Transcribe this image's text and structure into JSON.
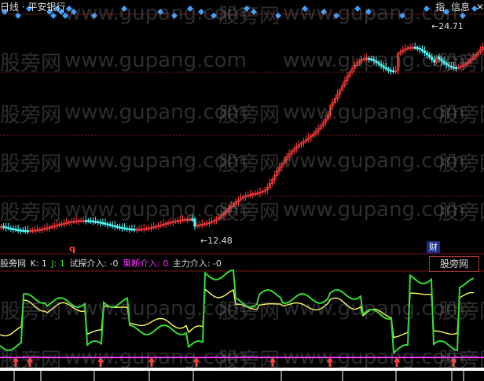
{
  "header": {
    "title": "日线 · 平安银行",
    "btn_index": "指",
    "btn_info": "信息",
    "btn_close": "✕"
  },
  "price_panel": {
    "high_label": "24.71",
    "low_label": "12.48",
    "marker_q": "q",
    "badge": "财"
  },
  "indicator_bar": {
    "name": "股旁网",
    "k_label": "K: 1",
    "j_label": "J: 1",
    "probe_label": "试探介入: -0",
    "decisive_label": "果断介入: 0",
    "main_label": "主力介入: -0",
    "tab_label": "股旁网"
  },
  "watermark": {
    "cn": "股旁网",
    "en": "www.gupang.com"
  },
  "colors": {
    "up": "#ff3c3c",
    "down": "#54ffff",
    "k_line": "#33dd33",
    "j_line": "#ffff66",
    "magenta": "#ff33ff",
    "diamond": "#3ca0ff",
    "grid": "#7a1a1a",
    "arrow": "#ff3c3c"
  }
}
